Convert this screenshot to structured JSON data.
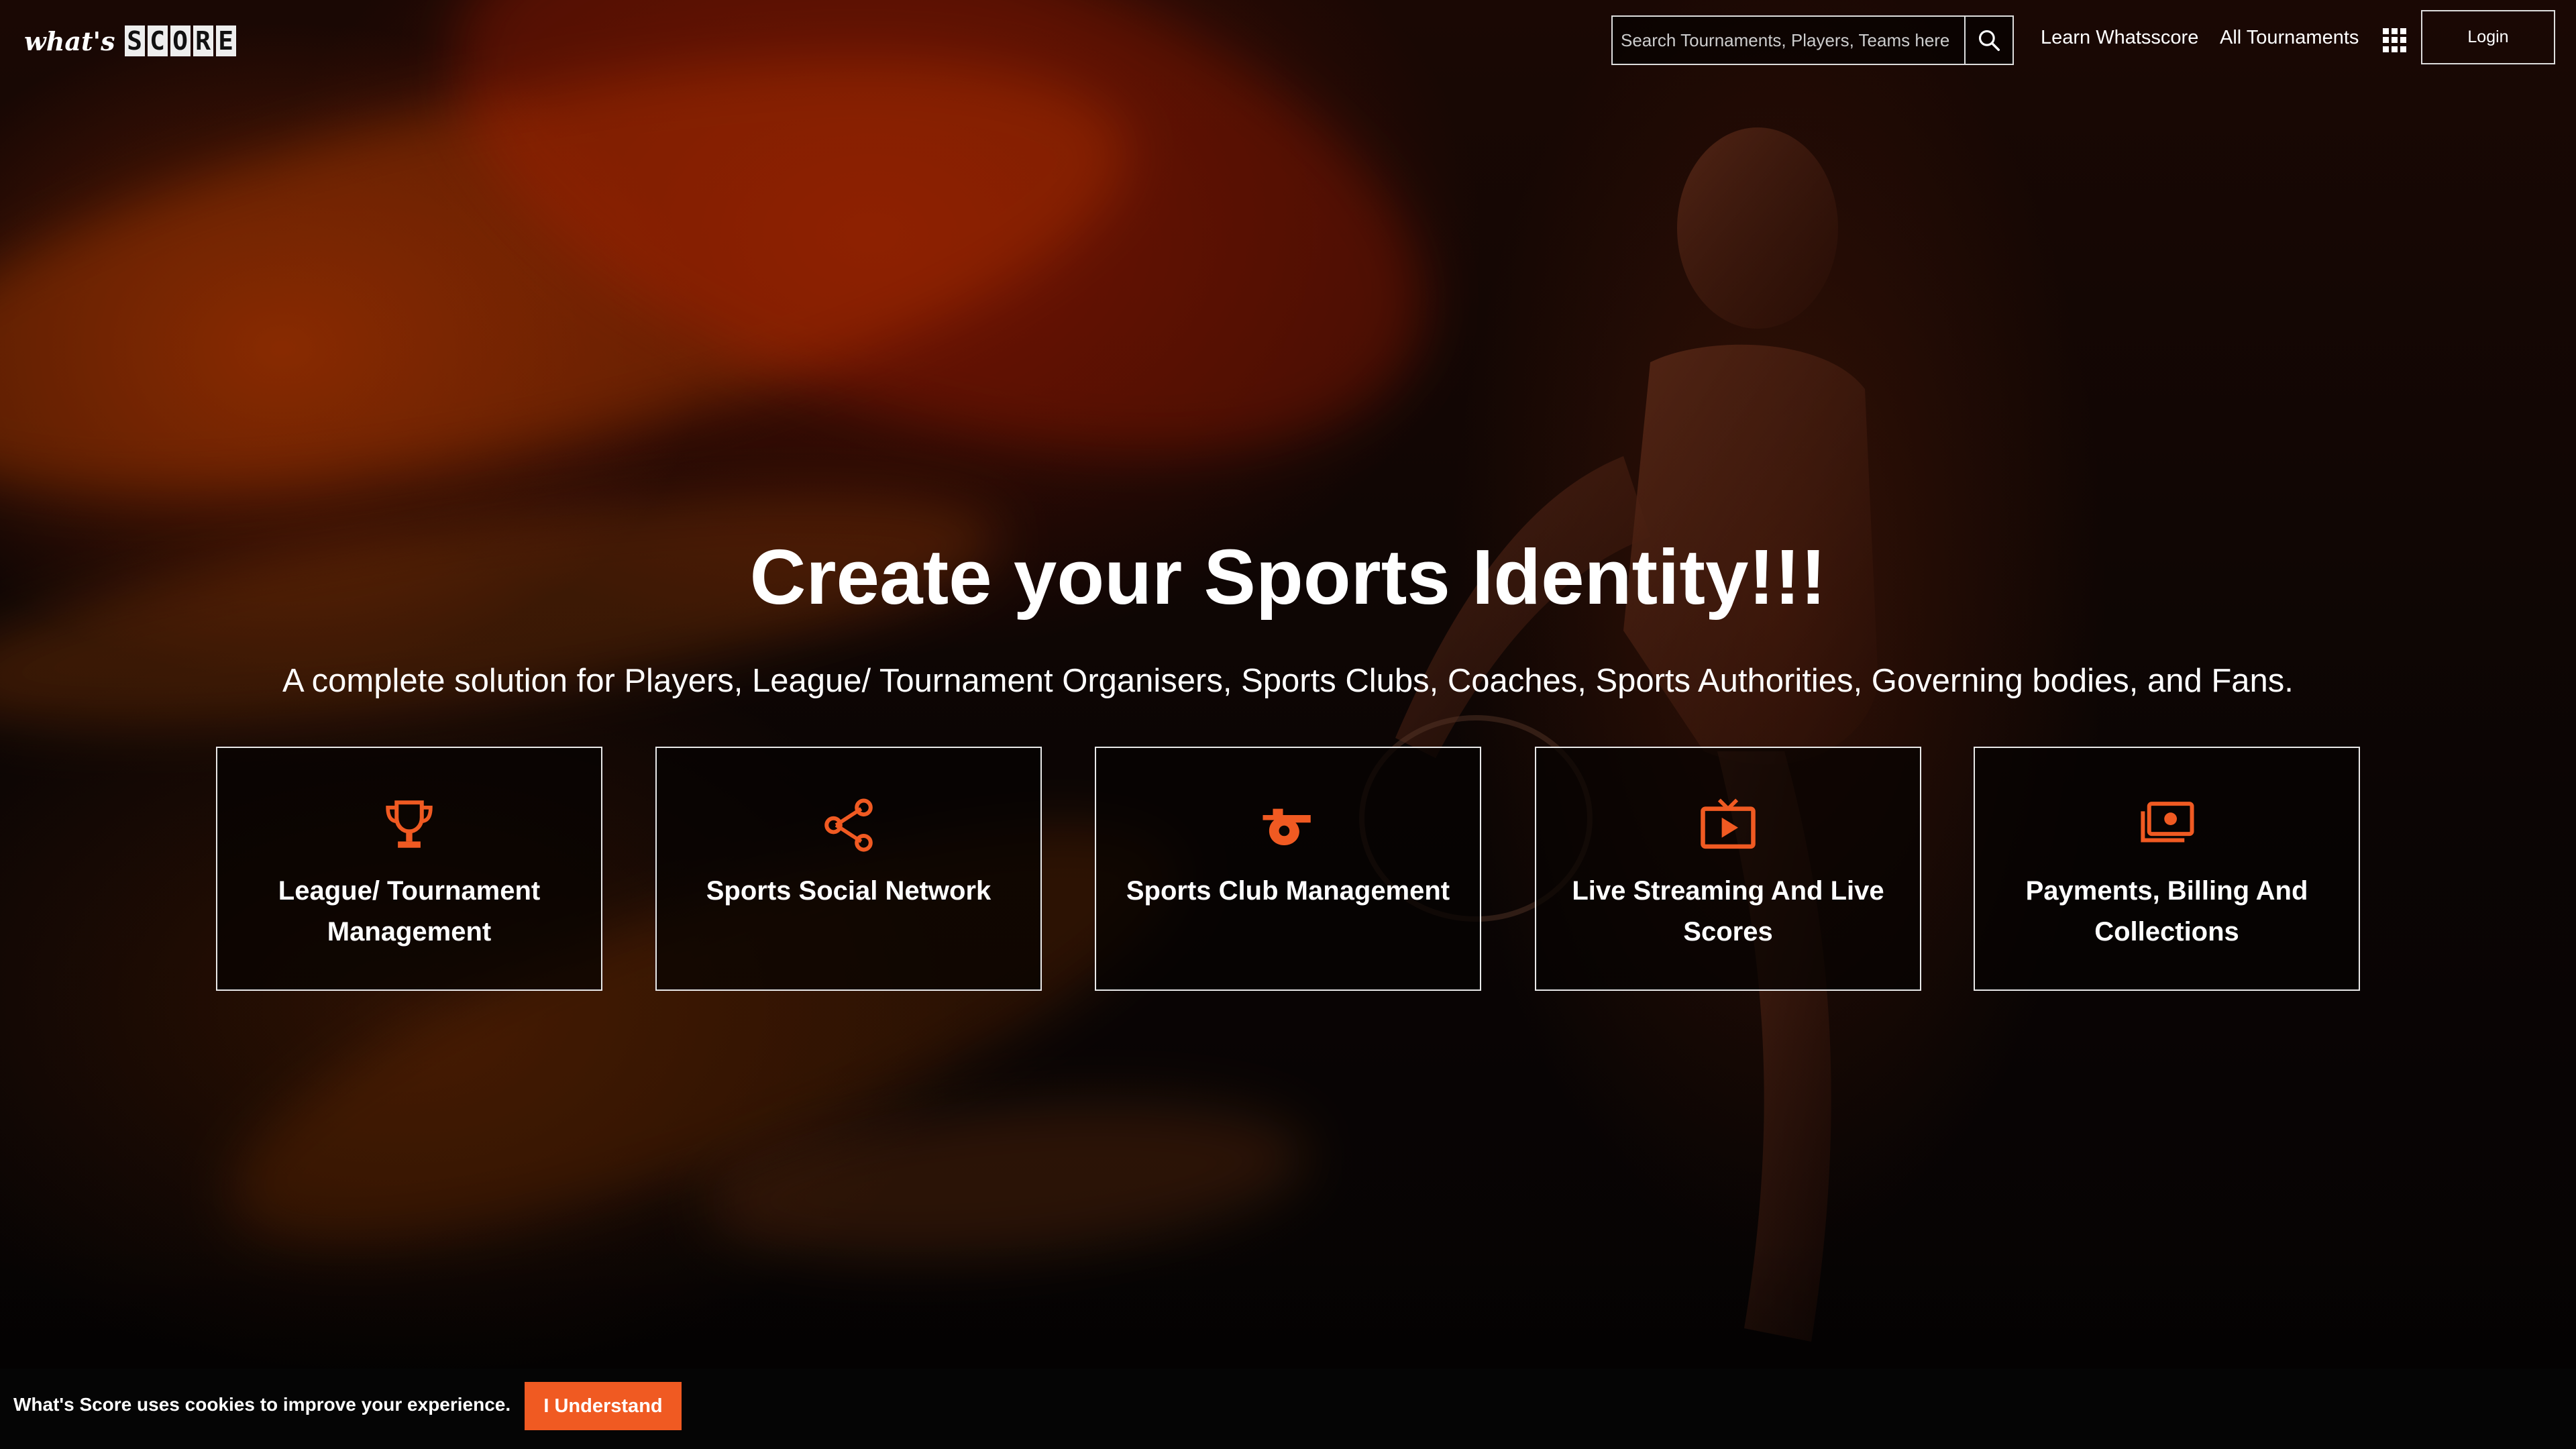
{
  "header": {
    "logo_whats": "what's",
    "logo_score_letters": [
      "S",
      "C",
      "O",
      "R",
      "E"
    ],
    "search": {
      "placeholder": "Search Tournaments, Players, Teams here"
    },
    "nav": {
      "learn": "Learn Whatsscore",
      "all_tournaments": "All Tournaments"
    },
    "login_label": "Login"
  },
  "hero": {
    "title": "Create your Sports Identity!!!",
    "subtitle": "A complete solution for Players, League/ Tournament Organisers, Sports Clubs, Coaches, Sports Authorities, Governing bodies, and Fans."
  },
  "cards": [
    {
      "label": "League/ Tournament Management",
      "icon": "trophy-icon"
    },
    {
      "label": "Sports Social Network",
      "icon": "share-icon"
    },
    {
      "label": "Sports Club Management",
      "icon": "whistle-icon"
    },
    {
      "label": "Live Streaming And Live Scores",
      "icon": "tv-play-icon"
    },
    {
      "label": "Payments, Billing And Collections",
      "icon": "money-icon"
    }
  ],
  "cookie": {
    "message": "What's Score uses cookies to improve your experience.",
    "button_label": "I Understand"
  },
  "colors": {
    "accent": "#f05a22",
    "card_border": "#e8e8e8",
    "background": "#080504"
  }
}
